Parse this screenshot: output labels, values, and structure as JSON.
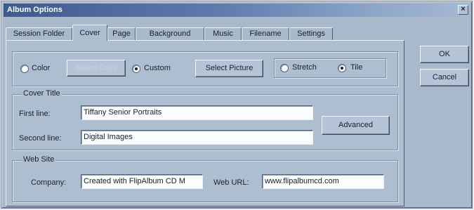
{
  "window": {
    "title": "Album Options",
    "close_glyph": "×"
  },
  "tabs": [
    {
      "label": "Session Folder"
    },
    {
      "label": "Cover",
      "active": true
    },
    {
      "label": "Page"
    },
    {
      "label": "Background"
    },
    {
      "label": "Music"
    },
    {
      "label": "Filename"
    },
    {
      "label": "Settings"
    }
  ],
  "cover_type": {
    "color_label": "Color",
    "select_color_label": "Select Color",
    "custom_label": "Custom",
    "select_picture_label": "Select Picture",
    "selected": "custom"
  },
  "fit": {
    "stretch_label": "Stretch",
    "tile_label": "Tile",
    "selected": "tile"
  },
  "cover_title": {
    "group_label": "Cover Title",
    "first_line_label": "First line:",
    "first_line_value": "Tiffany Senior Portraits",
    "second_line_label": "Second line:",
    "second_line_value": "Digital Images",
    "advanced_label": "Advanced"
  },
  "web_site": {
    "group_label": "Web Site",
    "company_label": "Company:",
    "company_value": "Created with FlipAlbum CD M",
    "url_label": "Web URL:",
    "url_value": "www.flipalbumcd.com"
  },
  "buttons": {
    "ok_label": "OK",
    "cancel_label": "Cancel"
  },
  "colors": {
    "titlebar": "#3f5a8e",
    "face": "#a9b9cc"
  }
}
